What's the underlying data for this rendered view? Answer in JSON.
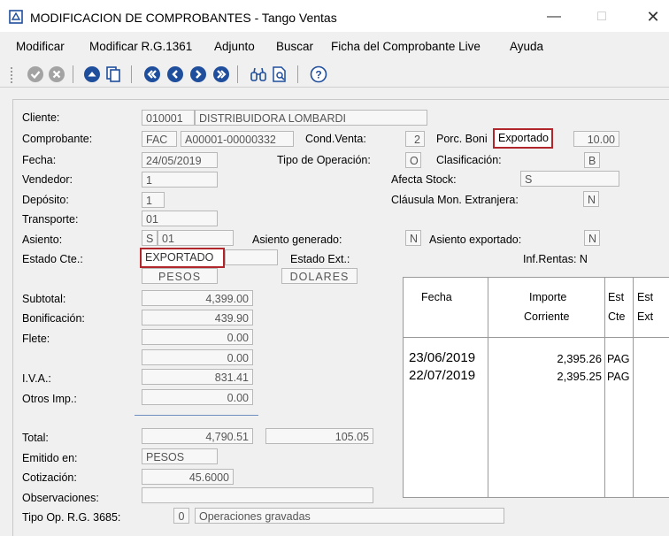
{
  "window": {
    "title": "MODIFICACION DE COMPROBANTES - Tango Ventas"
  },
  "menu": [
    "Modificar",
    "Modificar R.G.1361",
    "Adjunto",
    "Buscar",
    "Ficha del Comprobante Live",
    "Ayuda"
  ],
  "form": {
    "cliente_label": "Cliente:",
    "cliente_code": "010001",
    "cliente_name": "DISTRIBUIDORA LOMBARDI",
    "comprobante_label": "Comprobante:",
    "comprobante_tipo": "FAC",
    "comprobante_numero": "A00001-00000332",
    "cond_venta_label": "Cond.Venta:",
    "cond_venta": "2",
    "porc_boni_label": "Porc. Boni",
    "exportado_tag": "Exportado",
    "porc_boni": "10.00",
    "fecha_label": "Fecha:",
    "fecha": "24/05/2019",
    "tipo_operacion_label": "Tipo de Operación:",
    "tipo_operacion": "O",
    "clasificacion_label": "Clasificación:",
    "clasificacion": "B",
    "vendedor_label": "Vendedor:",
    "vendedor": "1",
    "afecta_stock_label": "Afecta Stock:",
    "afecta_stock": "S",
    "deposito_label": "Depósito:",
    "deposito": "1",
    "clausula_label": "Cláusula Mon. Extranjera:",
    "clausula": "N",
    "transporte_label": "Transporte:",
    "transporte": "01",
    "asiento_label": "Asiento:",
    "asiento_flag": "S",
    "asiento": "01",
    "asiento_generado_label": "Asiento generado:",
    "asiento_generado": "N",
    "asiento_exportado_label": "Asiento exportado:",
    "asiento_exportado": "N",
    "estado_cte_label": "Estado Cte.:",
    "estado_cte": "EXPORTADO",
    "estado_ext_label": "Estado Ext.:",
    "inf_rentas": "Inf.Rentas: N",
    "moneda_pesos": "PESOS",
    "moneda_dolares": "DOLARES"
  },
  "totals": {
    "subtotal_label": "Subtotal:",
    "subtotal": "4,399.00",
    "bonificacion_label": "Bonificación:",
    "bonificacion": "439.90",
    "flete_label": "Flete:",
    "flete": "0.00",
    "extra": "0.00",
    "iva_label": "I.V.A.:",
    "iva": "831.41",
    "otros_label": "Otros Imp.:",
    "otros": "0.00",
    "total_label": "Total:",
    "total": "4,790.51",
    "total_usd": "105.05",
    "emitido_label": "Emitido en:",
    "emitido": "PESOS",
    "cotizacion_label": "Cotización:",
    "cotizacion": "45.6000",
    "observaciones_label": "Observaciones:",
    "observaciones": "",
    "tipo_op_label": "Tipo Op. R.G. 3685:",
    "tipo_op_code": "0",
    "tipo_op_desc": "Operaciones gravadas"
  },
  "cuotas": {
    "headers": {
      "fecha": "Fecha",
      "importe1": "Importe",
      "importe2": "Corriente",
      "estcte1": "Est",
      "estcte2": "Cte",
      "estext1": "Est",
      "estext2": "Ext"
    },
    "rows": [
      {
        "fecha": "23/06/2019",
        "importe": "2,395.26",
        "est_cte": "PAG"
      },
      {
        "fecha": "22/07/2019",
        "importe": "2,395.25",
        "est_cte": "PAG"
      }
    ]
  },
  "icons": [
    "ok-icon",
    "cancel-icon",
    "up-icon",
    "copy-icon",
    "first-icon",
    "prev-icon",
    "next-icon",
    "last-icon",
    "binoculars-icon",
    "document-search-icon",
    "help-icon"
  ],
  "colors": {
    "highlight": "#b0262b",
    "nav_blue": "#1f4e9c",
    "disabled_gray": "#9a9a9a"
  }
}
